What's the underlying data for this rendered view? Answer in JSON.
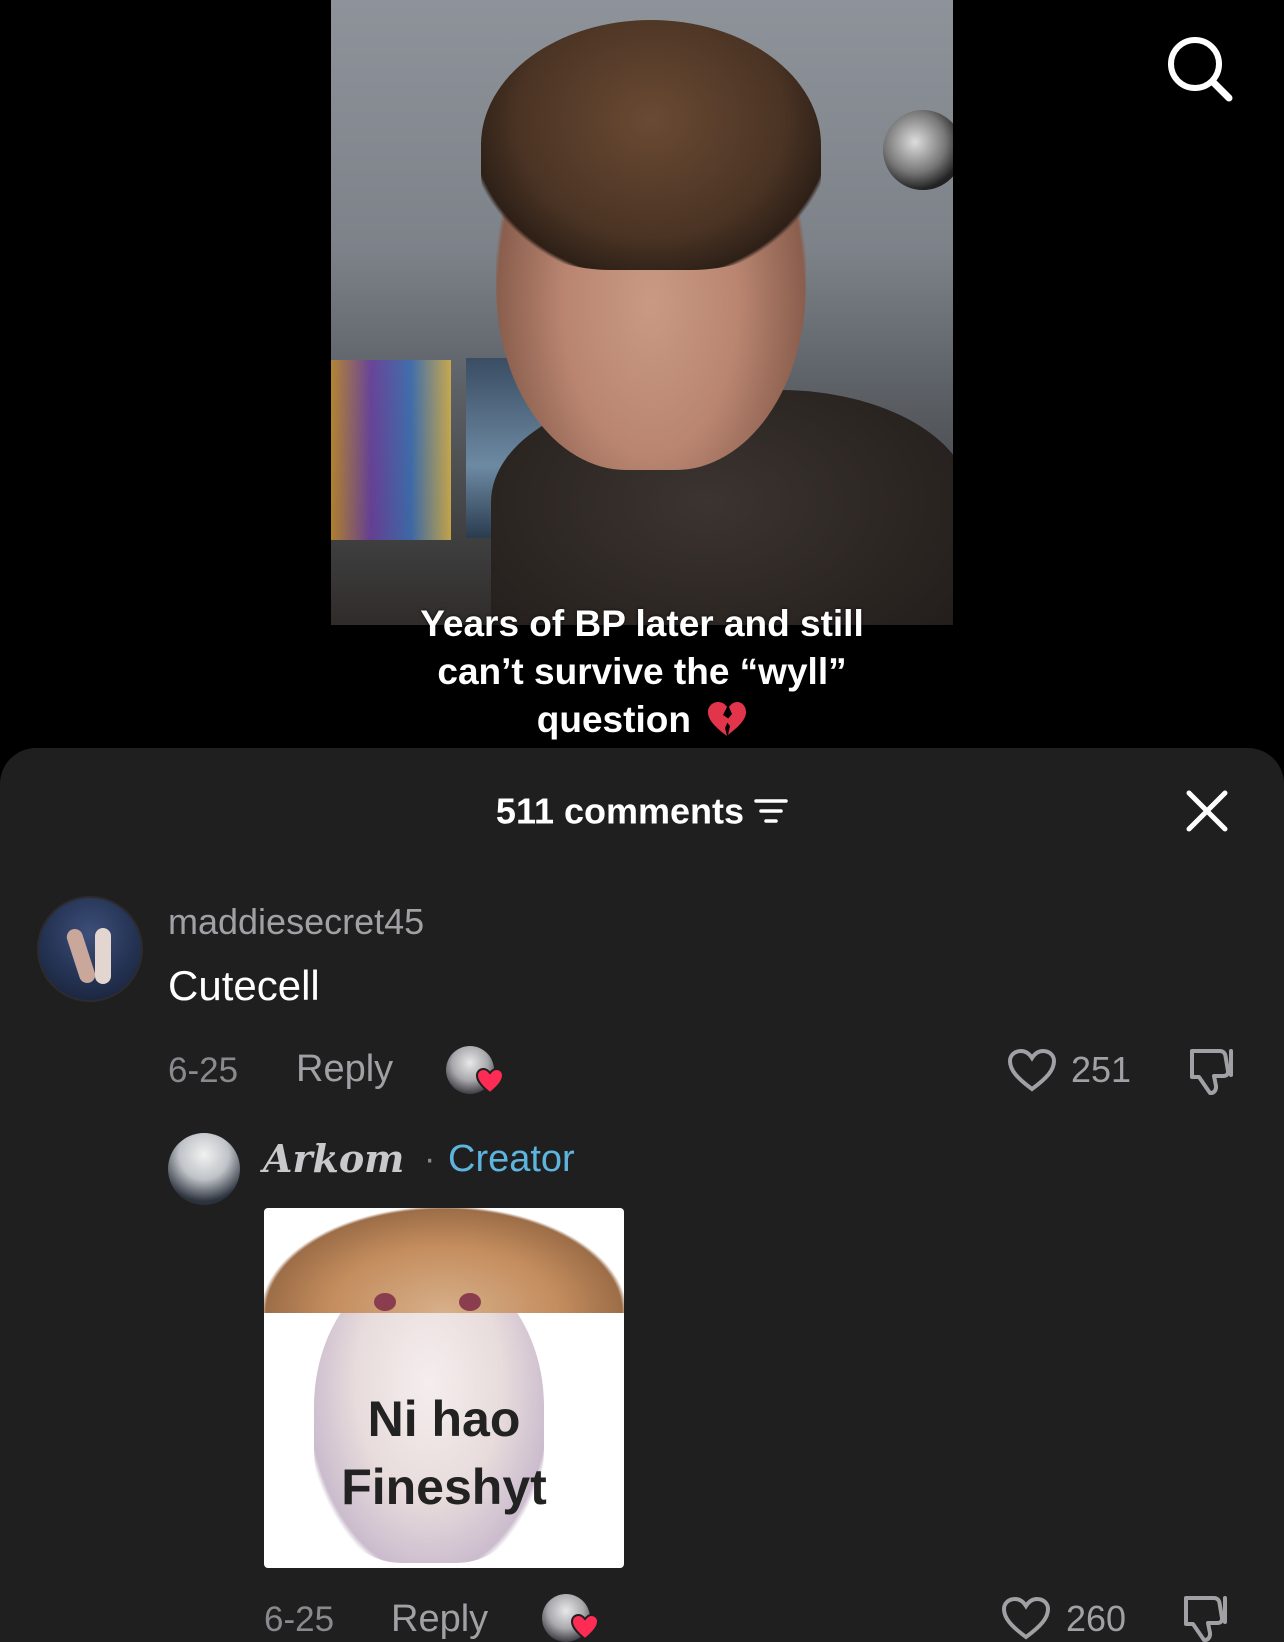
{
  "video": {
    "caption_line1": "Years of BP later and still",
    "caption_line2": "can’t survive the “wyll”",
    "caption_line3": "question",
    "caption_emoji": "broken-heart-icon"
  },
  "sheet": {
    "comment_count": "511 comments",
    "filter_icon": "filter-icon",
    "close_icon": "close-icon"
  },
  "comments": [
    {
      "username": "maddiesecret45",
      "text": "Cutecell",
      "date": "6-25",
      "reply_label": "Reply",
      "like_count": "251"
    }
  ],
  "replies": [
    {
      "username": "Arkom",
      "separator": "·",
      "badge": "Creator",
      "sticker_line1": "Ni hao",
      "sticker_line2": "Fineshyt",
      "date": "6-25",
      "reply_label": "Reply",
      "like_count": "260"
    }
  ],
  "colors": {
    "sheet_bg": "#1f1f20",
    "creator_badge": "#5db4dd",
    "heart_red": "#fe2c55"
  }
}
